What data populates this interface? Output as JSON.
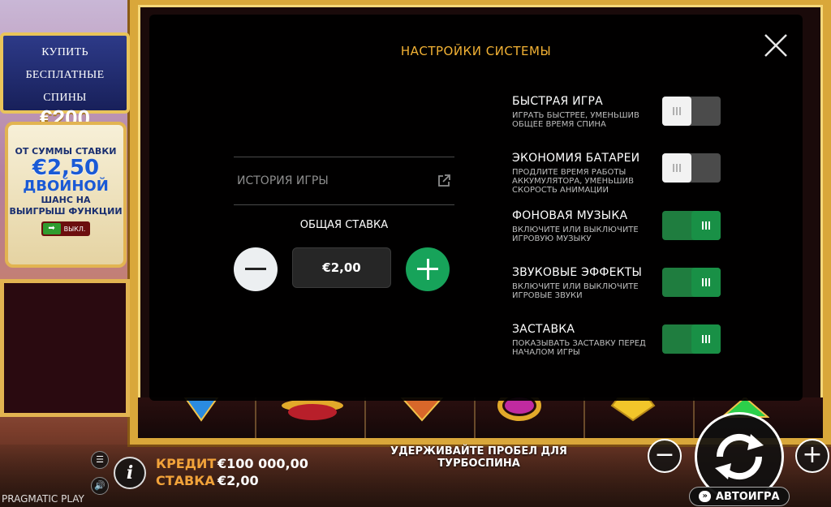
{
  "game": {
    "buy_panel": {
      "line1": "КУПИТЬ",
      "line2": "БЕСПЛАТНЫЕ",
      "line3": "СПИНЫ",
      "price": "€200"
    },
    "bet_panel": {
      "line1": "ОТ СУММЫ СТАВКИ",
      "amount": "€2,50",
      "double": "ДВОЙНОЙ",
      "chance1": "ШАНС НА",
      "chance2": "ВЫИГРЫШ ФУНКЦИИ",
      "toggle_label": "ВЫКЛ."
    },
    "credit_label": "КРЕДИТ",
    "credit_value": "€100 000,00",
    "bet_label": "СТАВКА",
    "bet_value": "€2,00",
    "brand": "PRAGMATIC PLAY",
    "turbo_hint1": "УДЕРЖИВАЙТЕ ПРОБЕЛ ДЛЯ",
    "turbo_hint2": "ТУРБОСПИНА",
    "autoplay_label": "АВТОИГРА",
    "info_icon": "i"
  },
  "settings": {
    "title": "НАСТРОЙКИ СИСТЕМЫ",
    "history_label": "ИСТОРИЯ ИГРЫ",
    "total_bet_title": "ОБЩАЯ СТАВКА",
    "total_bet_value": "€2,00",
    "options": [
      {
        "title": "БЫСТРАЯ ИГРА",
        "desc": [
          "ИГРАТЬ БЫСТРЕЕ, УМЕНЬШИВ",
          "ОБЩЕЕ ВРЕМЯ СПИНА"
        ],
        "enabled": false
      },
      {
        "title": "ЭКОНОМИЯ БАТАРЕИ",
        "desc": [
          "ПРОДЛИТЕ ВРЕМЯ РАБОТЫ",
          "АККУМУЛЯТОРА, УМЕНЬШИВ",
          "СКОРОСТЬ АНИМАЦИИ"
        ],
        "enabled": false
      },
      {
        "title": "ФОНОВАЯ МУЗЫКА",
        "desc": [
          "ВКЛЮЧИТЕ ИЛИ ВЫКЛЮЧИТЕ",
          "ИГРОВУЮ МУЗЫКУ"
        ],
        "enabled": true
      },
      {
        "title": "ЗВУКОВЫЕ ЭФФЕКТЫ",
        "desc": [
          "ВКЛЮЧИТЕ ИЛИ ВЫКЛЮЧИТЕ",
          "ИГРОВЫЕ ЗВУКИ"
        ],
        "enabled": true
      },
      {
        "title": "ЗАСТАВКА",
        "desc": [
          "ПОКАЗЫВАТЬ ЗАСТАВКУ ПЕРЕД",
          "НАЧАЛОМ ИГРЫ"
        ],
        "enabled": true
      }
    ]
  },
  "colors": {
    "accent": "#f2b134",
    "toggle_on": "#1f7d3f",
    "plus": "#17a35a",
    "credit_label": "#f2a33a"
  }
}
